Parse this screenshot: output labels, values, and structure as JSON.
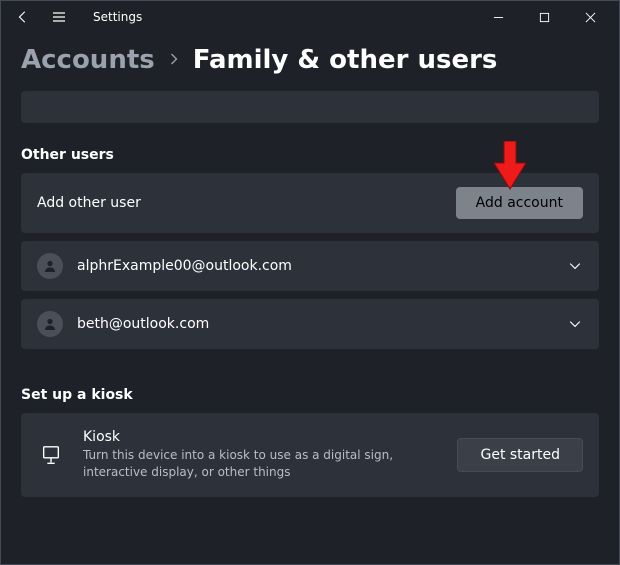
{
  "titlebar": {
    "label": "Settings"
  },
  "breadcrumb": {
    "parent": "Accounts",
    "current": "Family & other users"
  },
  "sections": {
    "other_users": {
      "title": "Other users",
      "add_label": "Add other user",
      "add_button": "Add account",
      "users": [
        {
          "email": "alphrExample00@outlook.com"
        },
        {
          "email": "beth@outlook.com"
        }
      ]
    },
    "kiosk": {
      "title": "Set up a kiosk",
      "item_title": "Kiosk",
      "item_desc": "Turn this device into a kiosk to use as a digital sign, interactive display, or other things",
      "button": "Get started"
    }
  },
  "annotation": {
    "arrow_points_to": "add-account-button"
  }
}
